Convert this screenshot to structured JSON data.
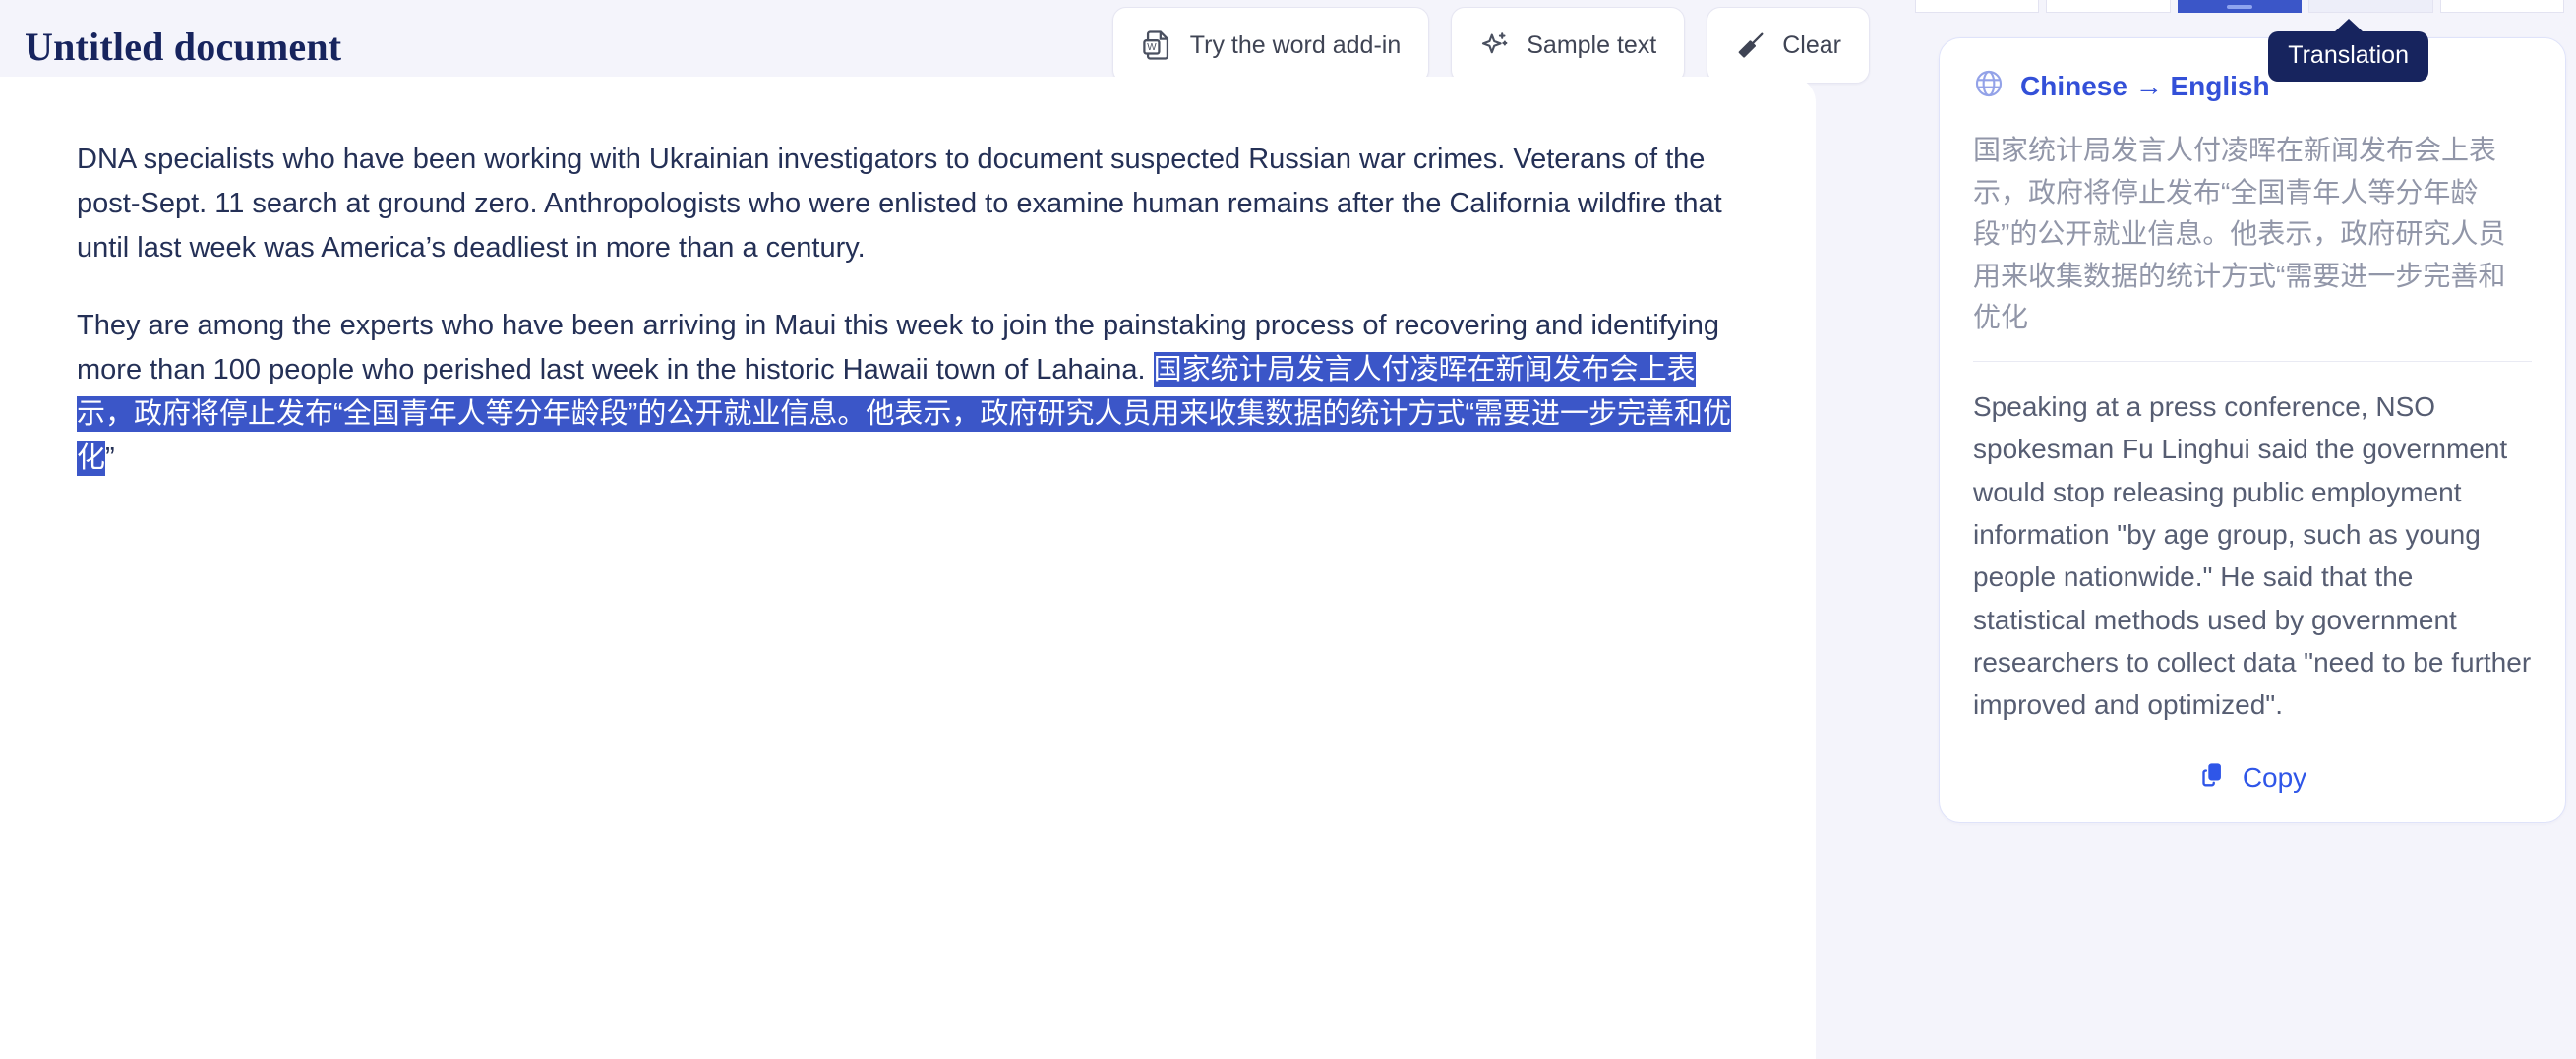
{
  "header": {
    "title": "Untitled document",
    "actions": [
      {
        "icon": "word-document-icon",
        "label": "Try the word add-in"
      },
      {
        "icon": "sparkle-star-icon",
        "label": "Sample text"
      },
      {
        "icon": "broom-icon",
        "label": "Clear"
      }
    ]
  },
  "document": {
    "paragraphs": [
      "DNA specialists who have been working with Ukrainian investigators to document suspected Russian war crimes. Veterans of the post-Sept. 11 search at ground zero. Anthropologists who were enlisted to examine human remains after the California wildfire that until last week was America’s deadliest in more than a century.",
      "They are among the experts who have been arriving in Maui this week to join the painstaking process of recovering and identifying more than 100 people who perished last week in the historic Hawaii town of Lahaina."
    ],
    "selected_text": "国家统计局发言人付凌晖在新闻发布会上表示，政府将停止发布“全国青年人等分年龄段”的公开就业信息。他表示，政府研究人员用来收集数据的统计方式“需要进一步完善和优化",
    "trailing_quote": "”",
    "selection_color": "#3b56c8"
  },
  "sidebar": {
    "tooltip": "Translation",
    "tabs": [
      {
        "label": "",
        "state": "inactive"
      },
      {
        "label": "",
        "state": "inactive"
      },
      {
        "label": "",
        "state": "active"
      },
      {
        "label": "",
        "state": "ghost"
      },
      {
        "label": "",
        "state": "inactive"
      }
    ],
    "card": {
      "icon": "globe-icon",
      "language_pair": "Chinese → English",
      "source_text": "国家统计局发言人付凌晖在新闻发布会上表示，政府将停止发布“全国青年人等分年龄段”的公开就业信息。他表示，政府研究人员用来收集数据的统计方式“需要进一步完善和优化",
      "output_text": "Speaking at a press conference, NSO spokesman Fu Linghui said the government would stop releasing public employment information \"by age group, such as young people nationwide.\" He said that the statistical methods used by government researchers to collect data \"need to be further improved and optimized\".",
      "copy_label": "Copy",
      "accent_color": "#2f56e8"
    }
  }
}
